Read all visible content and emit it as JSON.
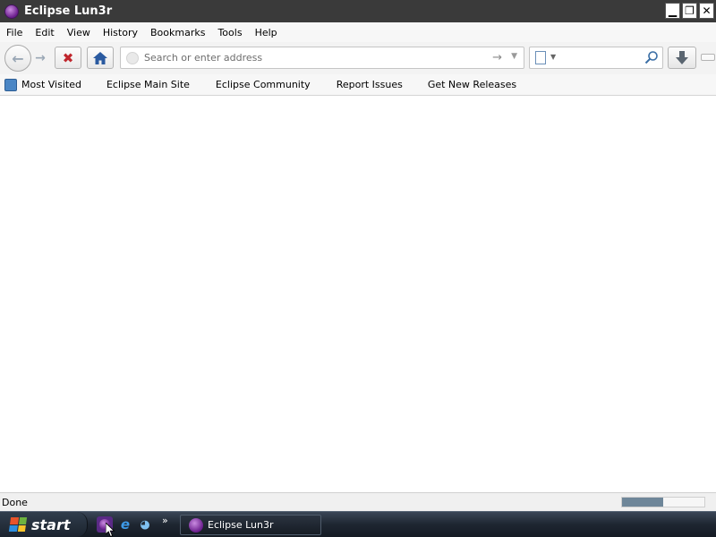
{
  "window": {
    "title": "Eclipse Lun3r",
    "icon": "eclipse-icon",
    "controls": {
      "minimize": "▁",
      "restore": "❐",
      "close": "✕"
    }
  },
  "menu": [
    "File",
    "Edit",
    "View",
    "History",
    "Bookmarks",
    "Tools",
    "Help"
  ],
  "toolbar": {
    "back_icon": "back-arrow-icon",
    "forward_icon": "forward-arrow-icon",
    "stop_icon": "stop-icon",
    "home_icon": "home-icon",
    "address_placeholder": "Search or enter address",
    "address_value": "",
    "search_value": "",
    "download_icon": "download-icon"
  },
  "bookmarks": [
    {
      "label": "Most Visited",
      "icon": "most-visited-icon"
    },
    {
      "label": "Eclipse Main Site"
    },
    {
      "label": "Eclipse Community"
    },
    {
      "label": "Report Issues"
    },
    {
      "label": "Get New Releases"
    }
  ],
  "status": {
    "text": "Done",
    "progress_fraction": 0.5
  },
  "taskbar": {
    "start_label": "start",
    "quick_launch": [
      "eclipse-icon",
      "internet-explorer-icon",
      "ie-update-icon"
    ],
    "more_label": "»",
    "task_label": "Eclipse Lun3r"
  },
  "colors": {
    "titlebar": "#3a3a3a",
    "taskbar": "#1e2631",
    "progress_fill": "#6e8699",
    "stop": "#c0262d",
    "accent_purple": "#6a1d8c"
  }
}
